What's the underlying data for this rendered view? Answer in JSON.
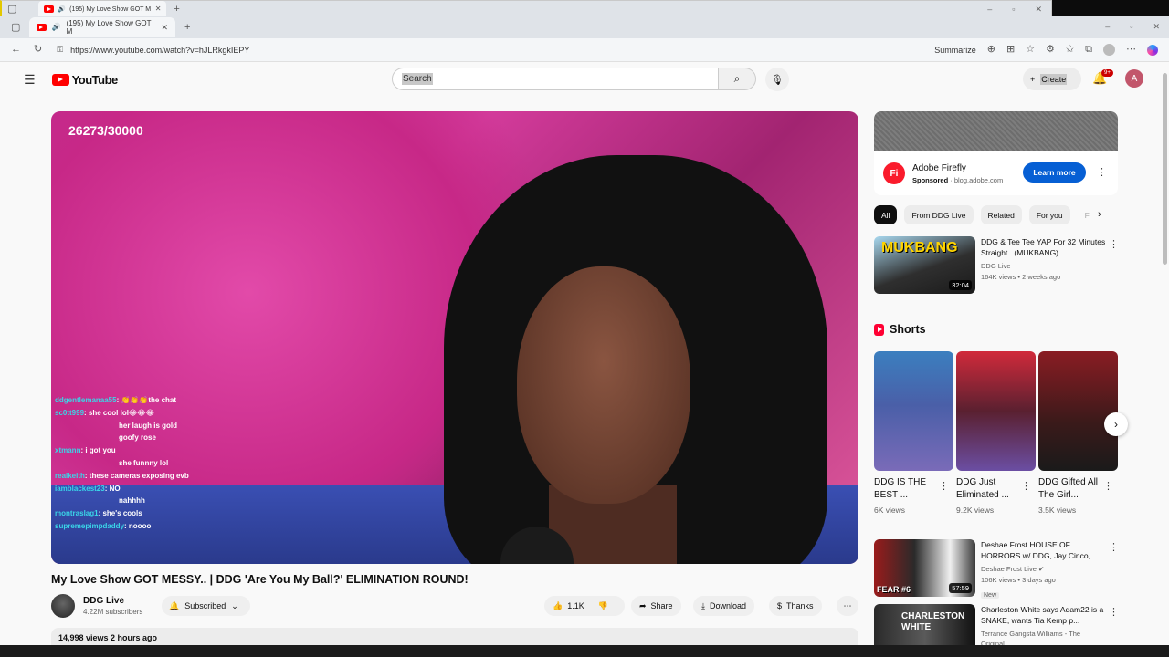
{
  "browser": {
    "tab_title": "(195) My Love Show GOT M",
    "back_tab_title": "(195) My Love Show GOT M",
    "url": "https://www.youtube.com/watch?v=hJLRkgkIEPY",
    "summarize_label": "Summarize"
  },
  "header": {
    "logo_text": "YouTube",
    "search_placeholder": "Search",
    "create_label": "Create",
    "notification_count": "9+",
    "account_initial": "A"
  },
  "player": {
    "counter": "26273/30000",
    "chat": [
      {
        "user": "ddgentlemanaa55",
        "msg": ": 👏👏👏the chat"
      },
      {
        "user": "sc0tt999",
        "msg": ": she cool lol😂😂😂"
      },
      {
        "user": "",
        "msg": "her laugh is gold"
      },
      {
        "user": "",
        "msg": "goofy rose"
      },
      {
        "user": "xtmann",
        "msg": ": i got you"
      },
      {
        "user": "",
        "msg": "she funnny lol"
      },
      {
        "user": "realkeith",
        "msg": ": these cameras exposing evb"
      },
      {
        "user": "iamblackest23",
        "msg": ": NO"
      },
      {
        "user": "",
        "msg": "nahhhh"
      },
      {
        "user": "montraslag1",
        "msg": ": she's cools"
      },
      {
        "user": "supremepimpdaddy",
        "msg": ": noooo"
      }
    ]
  },
  "video": {
    "title": "My Love Show GOT MESSY.. | DDG 'Are You My Ball?' ELIMINATION ROUND!",
    "channel_name": "DDG Live",
    "subscribers": "4.22M subscribers",
    "subscribed_label": "Subscribed",
    "likes": "1.1K",
    "share_label": "Share",
    "download_label": "Download",
    "thanks_label": "Thanks",
    "views_time": "14,998 views  2 hours ago"
  },
  "ad": {
    "logo": "Fi",
    "title": "Adobe Firefly",
    "sponsored": "Sponsored",
    "domain": "blog.adobe.com",
    "cta": "Learn more"
  },
  "chips": [
    "All",
    "From DDG Live",
    "Related",
    "For you",
    "F"
  ],
  "recommendations": [
    {
      "title": "DDG & Tee Tee YAP For 32 Minutes Straight.. (MUKBANG)",
      "channel": "DDG Live",
      "stats": "164K views • 2 weeks ago",
      "duration": "32:04",
      "thumb_text": "MUKBANG"
    },
    {
      "title": "Deshae Frost HOUSE OF HORRORS w/ DDG, Jay Cinco, ...",
      "channel": "Deshae Frost Live",
      "stats": "106K views • 3 days ago",
      "duration": "57:59",
      "tag": "New",
      "thumb_text": "FEAR #6"
    },
    {
      "title": "Charleston White says Adam22 is a SNAKE, wants Tia Kemp p...",
      "channel": "Terrance Gangsta Williams - The Original...",
      "stats": "",
      "duration": "",
      "thumb_text": "CHARLESTON WHITE"
    }
  ],
  "shorts": {
    "heading": "Shorts",
    "items": [
      {
        "title": "DDG IS THE BEST ...",
        "views": "6K views"
      },
      {
        "title": "DDG Just Eliminated ...",
        "views": "9.2K views"
      },
      {
        "title": "DDG Gifted All The Girl...",
        "views": "3.5K views"
      }
    ]
  },
  "colors": {
    "brand_red": "#ff0000",
    "cta_blue": "#065fd4",
    "background": "#f9f9f9"
  }
}
